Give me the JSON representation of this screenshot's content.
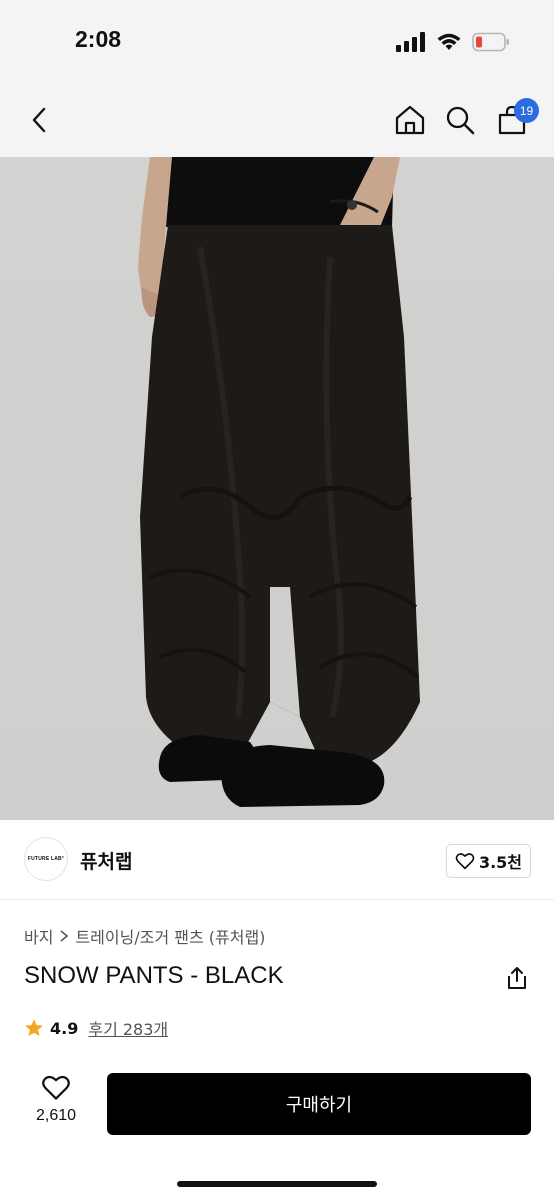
{
  "status_bar": {
    "time": "2:08",
    "battery_color": "#e5483c"
  },
  "nav": {
    "back_icon": "chevron-left-icon",
    "home_icon": "home-icon",
    "search_icon": "search-icon",
    "cart_icon": "bag-icon",
    "cart_count": "19",
    "badge_color": "#2d6cdf"
  },
  "hero": {
    "image_subject": "black wide-leg snow pants photo"
  },
  "brand": {
    "logo_text": "FUTURE LAB°",
    "name": "퓨처랩",
    "likes": "3.5천"
  },
  "breadcrumb": {
    "category": "바지",
    "subcategory": "트레이닝/조거 팬츠 (퓨처랩)"
  },
  "product": {
    "title": "SNOW PANTS - BLACK",
    "rating": "4.9",
    "reviews": "후기 283개",
    "star_color": "#f5a623"
  },
  "bottom_bar": {
    "wishlist_count": "2,610",
    "buy_label": "구매하기"
  }
}
